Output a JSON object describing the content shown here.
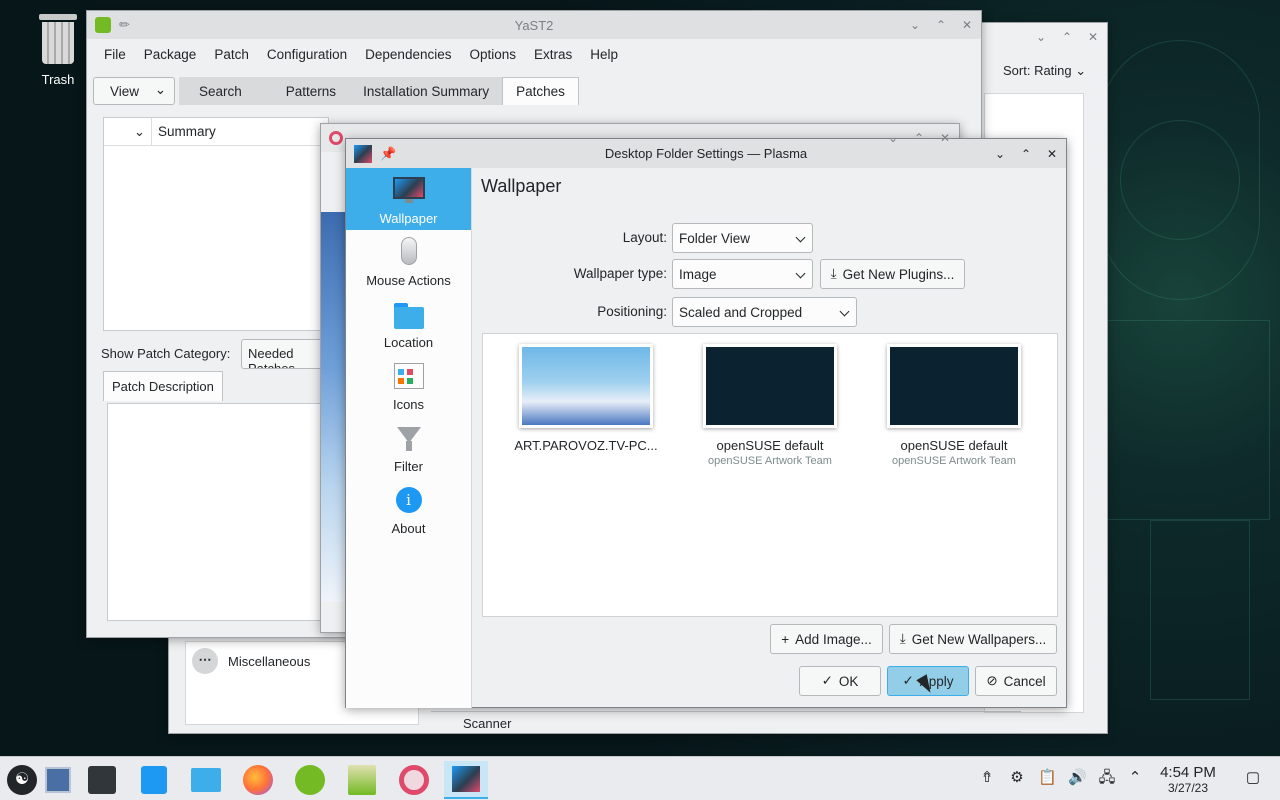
{
  "desktop": {
    "trash_label": "Trash"
  },
  "discover": {
    "sort_label": "Sort: Rating",
    "misc_label": "Miscellaneous",
    "scanner_label": "Scanner"
  },
  "yast": {
    "title": "YaST2",
    "menu": [
      "File",
      "Package",
      "Patch",
      "Configuration",
      "Dependencies",
      "Options",
      "Extras",
      "Help"
    ],
    "view_label": "View",
    "tabs": [
      "Search",
      "Patterns",
      "Installation Summary",
      "Patches"
    ],
    "active_tab": "Patches",
    "summary_header": "Summary",
    "show_patch_category": "Show Patch Category:",
    "patch_category_value": "Needed Patches",
    "patch_description_tab": "Patch Description"
  },
  "plasma": {
    "title": "Desktop Folder Settings — Plasma",
    "sidebar": [
      {
        "label": "Wallpaper",
        "icon": "wallpaper-icon",
        "active": true
      },
      {
        "label": "Mouse Actions",
        "icon": "mouse-icon",
        "active": false
      },
      {
        "label": "Location",
        "icon": "folder-icon",
        "active": false
      },
      {
        "label": "Icons",
        "icon": "icons-icon",
        "active": false
      },
      {
        "label": "Filter",
        "icon": "filter-icon",
        "active": false
      },
      {
        "label": "About",
        "icon": "info-icon",
        "active": false
      }
    ],
    "page_title": "Wallpaper",
    "layout_label": "Layout:",
    "layout_value": "Folder View",
    "wallpaper_type_label": "Wallpaper type:",
    "wallpaper_type_value": "Image",
    "get_new_plugins": "Get New Plugins...",
    "positioning_label": "Positioning:",
    "positioning_value": "Scaled and Cropped",
    "wallpapers": [
      {
        "name": "ART.PAROVOZ.TV-PC...",
        "author": ""
      },
      {
        "name": "openSUSE default",
        "author": "openSUSE Artwork Team"
      },
      {
        "name": "openSUSE default",
        "author": "openSUSE Artwork Team"
      }
    ],
    "add_image": "Add Image...",
    "get_new_wallpapers": "Get New Wallpapers...",
    "ok": "OK",
    "apply": "Apply",
    "cancel": "Cancel"
  },
  "taskbar": {
    "time": "4:54 PM",
    "date": "3/27/23"
  },
  "colors": {
    "accent": "#3daee9",
    "desktop_bg": "#0a1f22"
  }
}
